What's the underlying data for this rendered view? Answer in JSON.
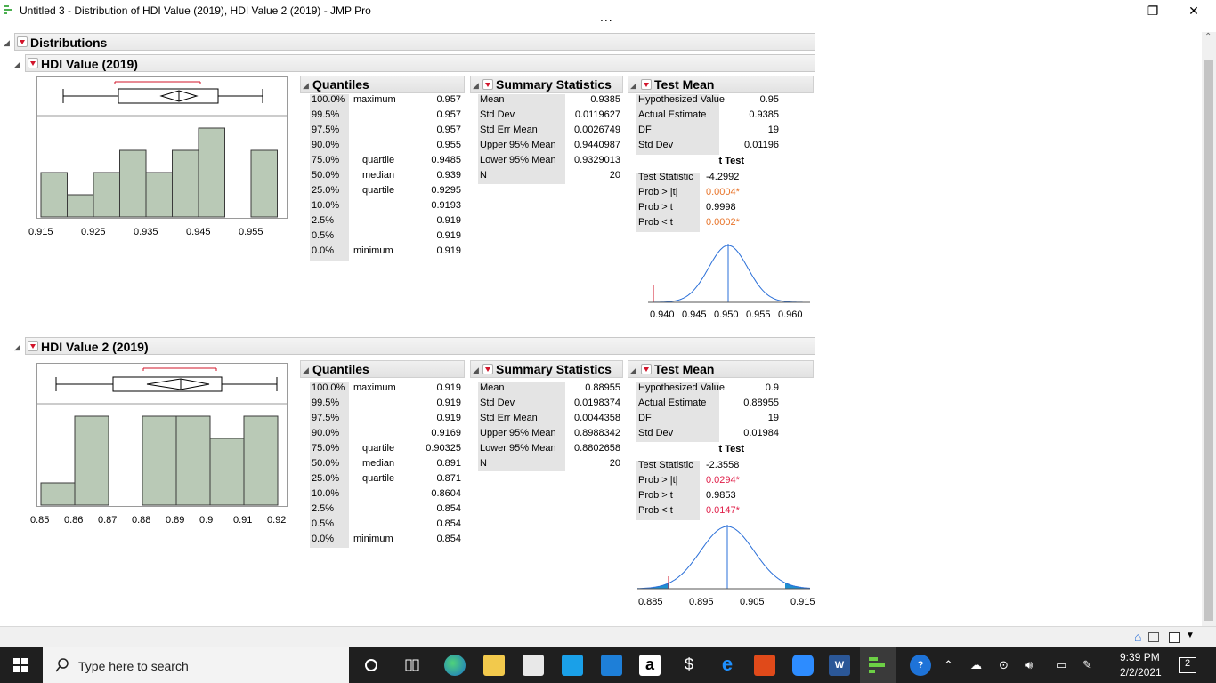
{
  "window": {
    "title": "Untitled 3 - Distribution of HDI Value (2019), HDI Value 2 (2019) - JMP Pro",
    "more": "...",
    "minimize": "—",
    "restore": "❐",
    "close": "✕"
  },
  "report": {
    "title": "Distributions",
    "sections": [
      {
        "title": "HDI Value (2019)",
        "hist_axis": [
          "0.915",
          "0.925",
          "0.935",
          "0.945",
          "0.955"
        ],
        "hist_counts": [
          2,
          1,
          2,
          3,
          2,
          3,
          4,
          0,
          3
        ],
        "quantiles": {
          "title": "Quantiles",
          "rows": [
            [
              "100.0%",
              "maximum",
              "0.957"
            ],
            [
              "99.5%",
              "",
              "0.957"
            ],
            [
              "97.5%",
              "",
              "0.957"
            ],
            [
              "90.0%",
              "",
              "0.955"
            ],
            [
              "75.0%",
              "quartile",
              "0.9485"
            ],
            [
              "50.0%",
              "median",
              "0.939"
            ],
            [
              "25.0%",
              "quartile",
              "0.9295"
            ],
            [
              "10.0%",
              "",
              "0.9193"
            ],
            [
              "2.5%",
              "",
              "0.919"
            ],
            [
              "0.5%",
              "",
              "0.919"
            ],
            [
              "0.0%",
              "minimum",
              "0.919"
            ]
          ]
        },
        "summary": {
          "title": "Summary Statistics",
          "rows": [
            [
              "Mean",
              "0.9385"
            ],
            [
              "Std Dev",
              "0.0119627"
            ],
            [
              "Std Err Mean",
              "0.0026749"
            ],
            [
              "Upper 95% Mean",
              "0.9440987"
            ],
            [
              "Lower 95% Mean",
              "0.9329013"
            ],
            [
              "N",
              "20"
            ]
          ]
        },
        "test_mean": {
          "title": "Test Mean",
          "rows": [
            [
              "Hypothesized Value",
              "0.95"
            ],
            [
              "Actual Estimate",
              "0.9385"
            ],
            [
              "DF",
              "19"
            ],
            [
              "Std Dev",
              "0.01196"
            ]
          ],
          "t_header": "t Test",
          "t_rows": [
            [
              "Test Statistic",
              "-4.2992"
            ],
            [
              "Prob > |t|",
              "0.0004*"
            ],
            [
              "Prob > t",
              "0.9998"
            ],
            [
              "Prob < t",
              "0.0002*"
            ]
          ],
          "curve_axis": [
            "0.940",
            "0.945",
            "0.950",
            "0.955",
            "0.960"
          ]
        }
      },
      {
        "title": "HDI Value 2 (2019)",
        "hist_axis": [
          "0.85",
          "0.86",
          "0.87",
          "0.88",
          "0.89",
          "0.9",
          "0.91",
          "0.92"
        ],
        "hist_counts": [
          1,
          4,
          0,
          4,
          4,
          3,
          4
        ],
        "quantiles": {
          "title": "Quantiles",
          "rows": [
            [
              "100.0%",
              "maximum",
              "0.919"
            ],
            [
              "99.5%",
              "",
              "0.919"
            ],
            [
              "97.5%",
              "",
              "0.919"
            ],
            [
              "90.0%",
              "",
              "0.9169"
            ],
            [
              "75.0%",
              "quartile",
              "0.90325"
            ],
            [
              "50.0%",
              "median",
              "0.891"
            ],
            [
              "25.0%",
              "quartile",
              "0.871"
            ],
            [
              "10.0%",
              "",
              "0.8604"
            ],
            [
              "2.5%",
              "",
              "0.854"
            ],
            [
              "0.5%",
              "",
              "0.854"
            ],
            [
              "0.0%",
              "minimum",
              "0.854"
            ]
          ]
        },
        "summary": {
          "title": "Summary Statistics",
          "rows": [
            [
              "Mean",
              "0.88955"
            ],
            [
              "Std Dev",
              "0.0198374"
            ],
            [
              "Std Err Mean",
              "0.0044358"
            ],
            [
              "Upper 95% Mean",
              "0.8988342"
            ],
            [
              "Lower 95% Mean",
              "0.8802658"
            ],
            [
              "N",
              "20"
            ]
          ]
        },
        "test_mean": {
          "title": "Test Mean",
          "rows": [
            [
              "Hypothesized Value",
              "0.9"
            ],
            [
              "Actual Estimate",
              "0.88955"
            ],
            [
              "DF",
              "19"
            ],
            [
              "Std Dev",
              "0.01984"
            ]
          ],
          "t_header": "t Test",
          "t_rows": [
            [
              "Test Statistic",
              "-2.3558"
            ],
            [
              "Prob > |t|",
              "0.0294*"
            ],
            [
              "Prob > t",
              "0.9853"
            ],
            [
              "Prob < t",
              "0.0147*"
            ]
          ],
          "curve_axis": [
            "0.885",
            "0.895",
            "0.905",
            "0.915"
          ]
        }
      }
    ]
  },
  "taskbar": {
    "search_placeholder": "Type here to search",
    "time": "9:39 PM",
    "date": "2/2/2021",
    "notifications": "2",
    "amazon_letter": "a",
    "word_letter": "W",
    "help_letter": "?"
  },
  "colors": {
    "bar_fill": "#b9c9b6",
    "bar_stroke": "#3a3a3a",
    "curve": "#2a6fd8",
    "shade": "#1f8fd0",
    "significant": "#e8742a"
  }
}
